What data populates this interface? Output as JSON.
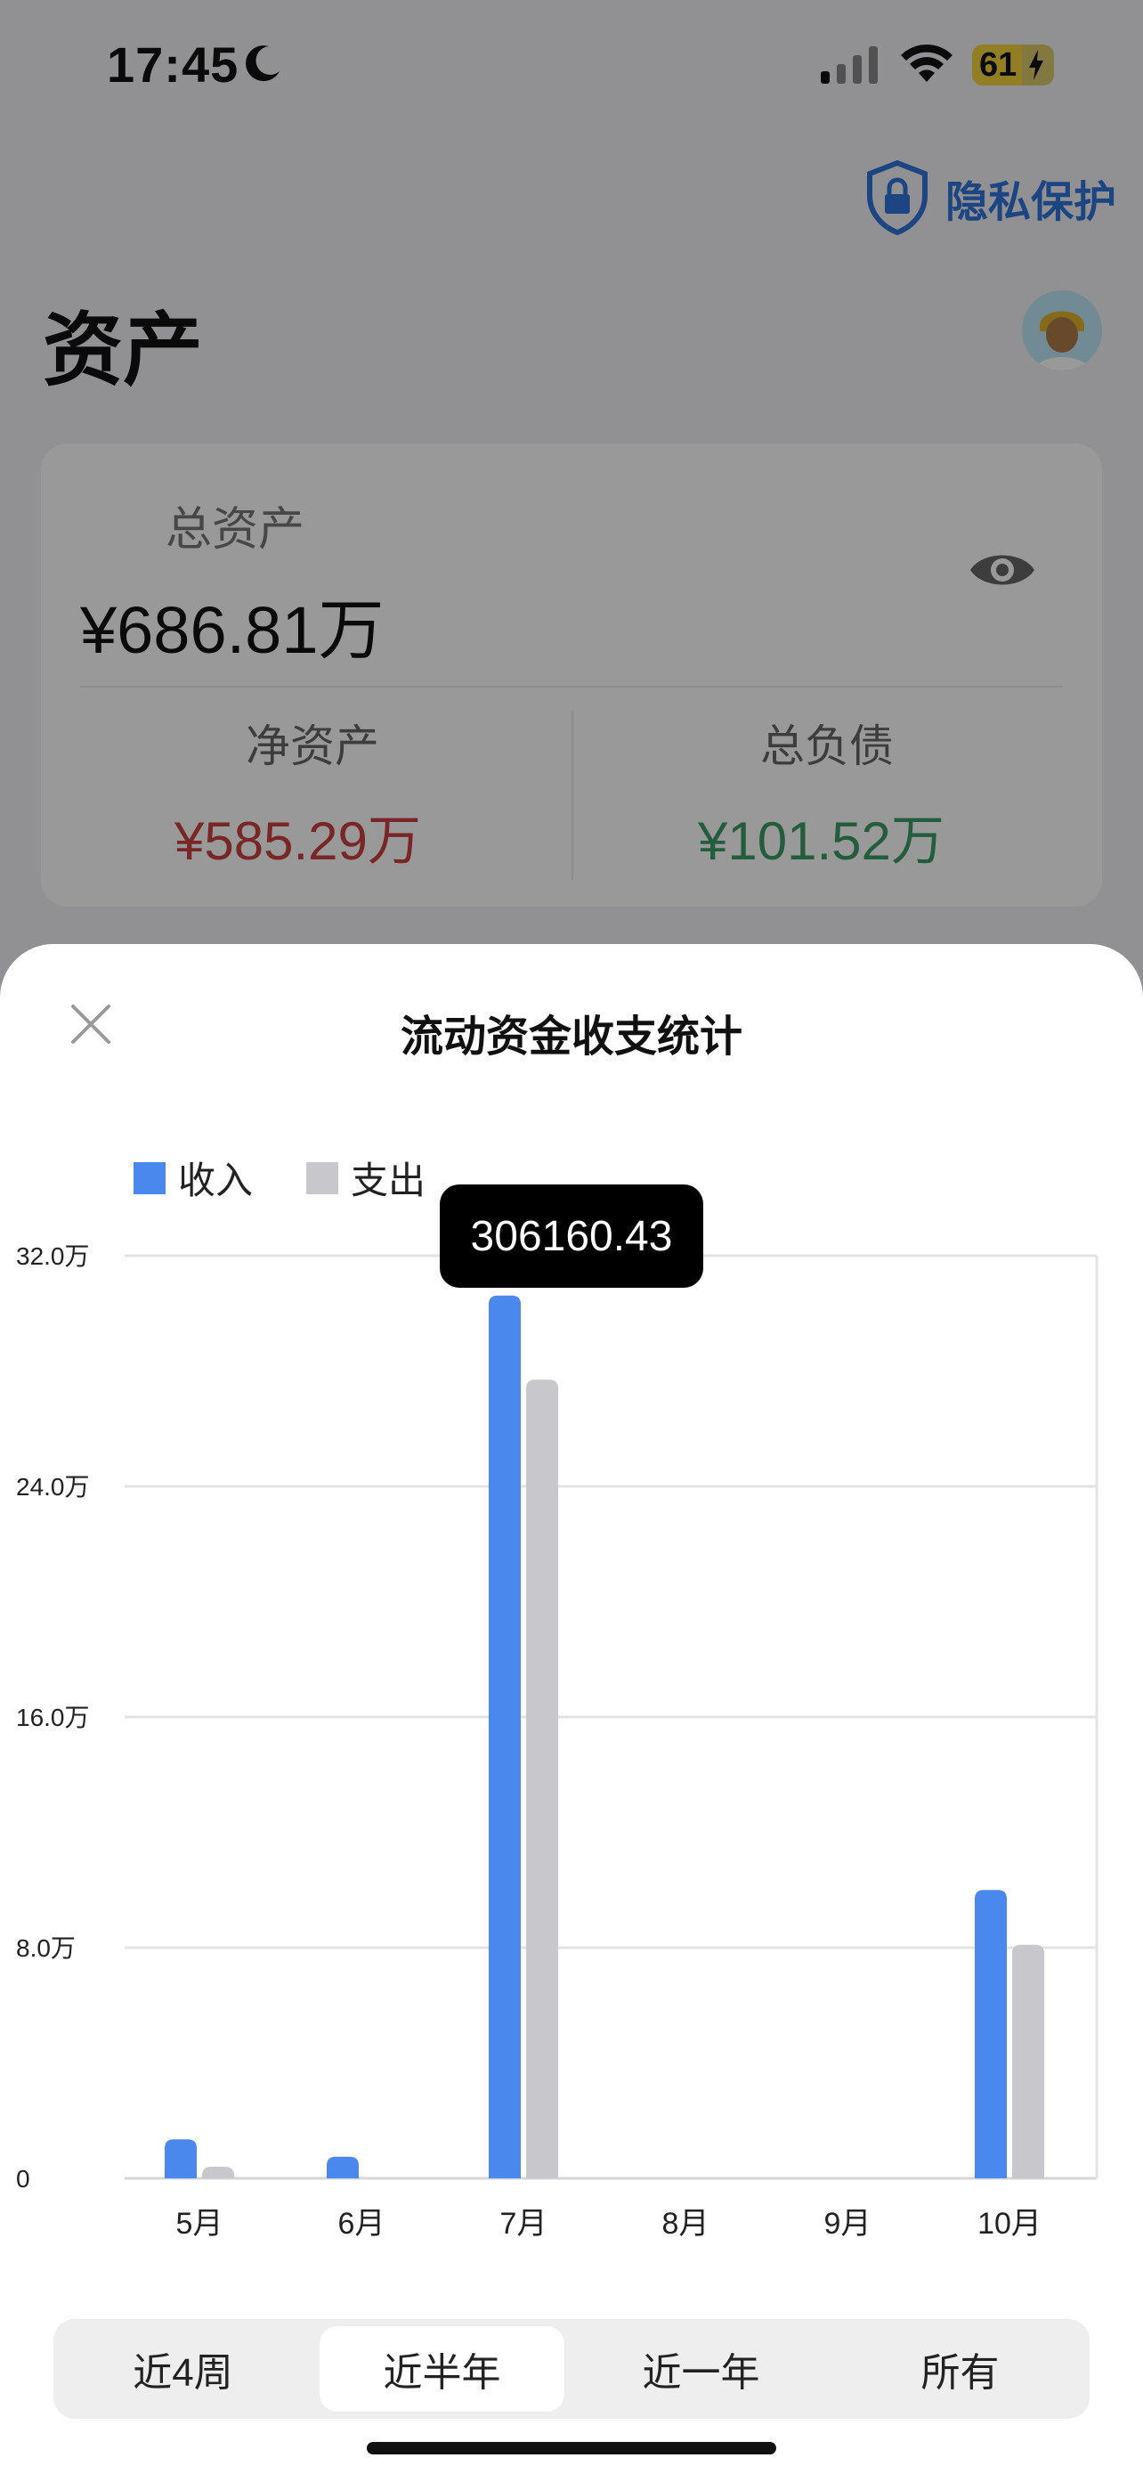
{
  "status_bar": {
    "time": "17:45",
    "battery": "61",
    "battery_level": 0.61
  },
  "header": {
    "privacy_label": "隐私保护",
    "page_title": "资产"
  },
  "asset_card": {
    "total_label": "总资产",
    "total_value": "¥686.81万",
    "net_label": "净资产",
    "net_value": "¥585.29万",
    "debt_label": "总负债",
    "debt_value": "¥101.52万"
  },
  "sheet": {
    "title": "流动资金收支统计",
    "tooltip": "306160.43",
    "periods": [
      "近4周",
      "近半年",
      "近一年",
      "所有"
    ],
    "active_period": "近半年"
  },
  "colors": {
    "income": "#4a88ed",
    "expense": "#c7c7cc",
    "tooltip_bg": "#000000",
    "privacy": "#2f73d8"
  },
  "chart_data": {
    "type": "bar",
    "categories": [
      "5月",
      "6月",
      "7月",
      "8月",
      "9月",
      "10月"
    ],
    "series": [
      {
        "name": "收入",
        "values": [
          13500,
          7500,
          306160.43,
          0,
          0,
          100000
        ]
      },
      {
        "name": "支出",
        "values": [
          4000,
          0,
          277000,
          0,
          0,
          81000
        ]
      }
    ],
    "y_ticks": [
      "0",
      "8.0万",
      "16.0万",
      "24.0万",
      "32.0万"
    ],
    "y_tick_values": [
      0,
      80000,
      160000,
      240000,
      320000
    ],
    "ylim": [
      0,
      320000
    ],
    "legend": "top-left",
    "grid": true
  }
}
